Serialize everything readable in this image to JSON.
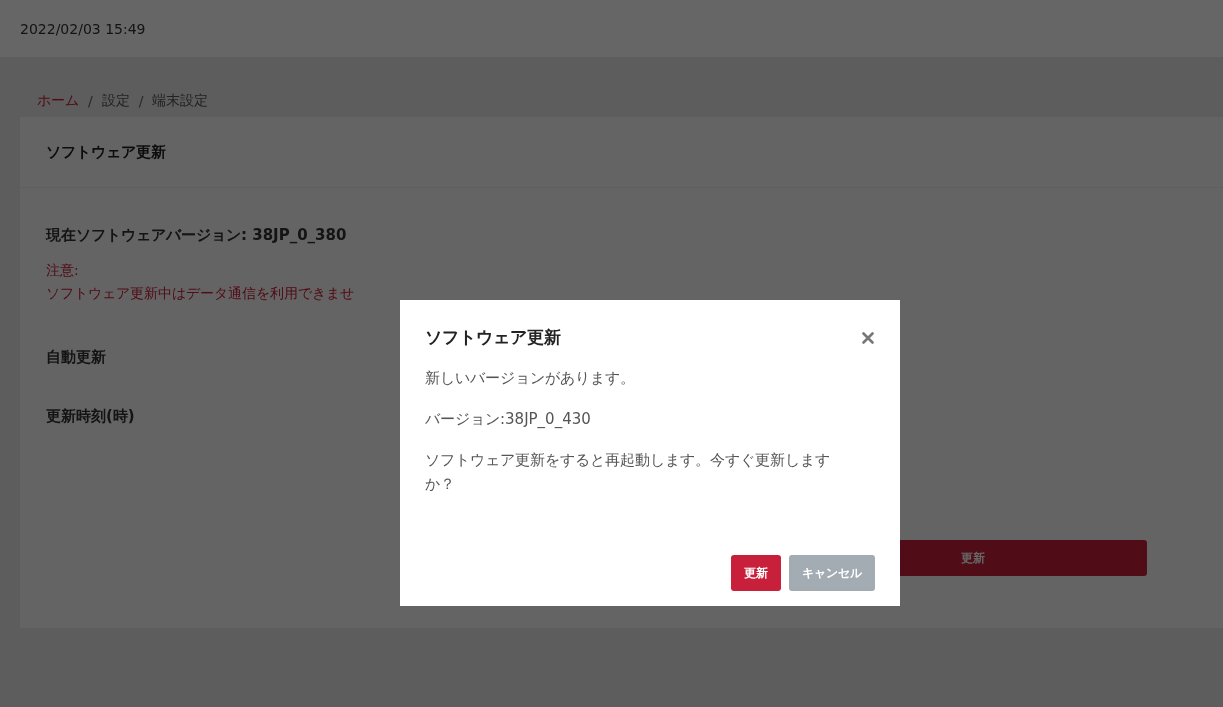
{
  "header": {
    "datetime": "2022/02/03 15:49"
  },
  "breadcrumb": {
    "separator": "/",
    "items": [
      {
        "label": "ホーム",
        "kind": "link"
      },
      {
        "label": "設定",
        "kind": "text"
      },
      {
        "label": "端末設定",
        "kind": "text"
      }
    ]
  },
  "card": {
    "title": "ソフトウェア更新",
    "current_version": "現在ソフトウェアバージョン: 38JP_0_380",
    "notice_label": "注意:",
    "notice_text": "ソフトウェア更新中はデータ通信を利用できませ",
    "fields": [
      {
        "label": "自動更新"
      },
      {
        "label": "更新時刻(時)"
      }
    ],
    "button": "更新"
  },
  "dialog": {
    "title": "ソフトウェア更新",
    "messages": [
      "新しいバージョンがあります。",
      "バージョン:38JP_0_430",
      "ソフトウェア更新をすると再起動します。今すぐ更新しますか？"
    ],
    "buttons": [
      {
        "label": "更新",
        "kind": "primary"
      },
      {
        "label": "キャンセル",
        "kind": "secondary"
      }
    ]
  }
}
